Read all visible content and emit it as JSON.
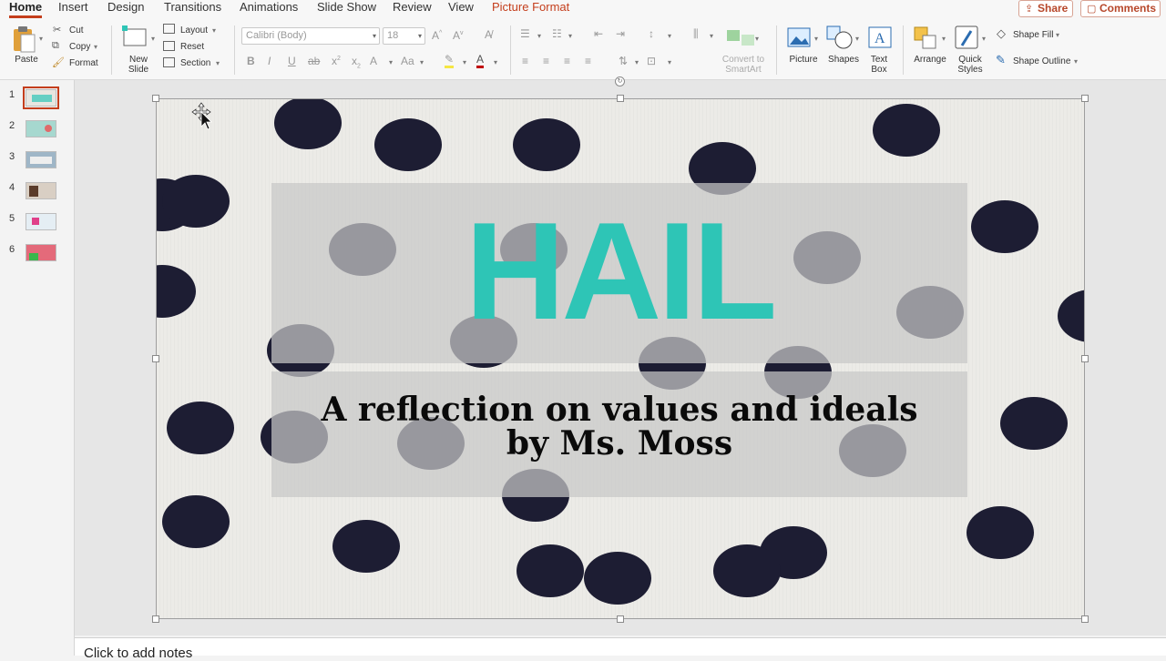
{
  "tabs": {
    "home": "Home",
    "insert": "Insert",
    "design": "Design",
    "transitions": "Transitions",
    "animations": "Animations",
    "slideshow": "Slide Show",
    "review": "Review",
    "view": "View",
    "picture_format": "Picture Format"
  },
  "header_buttons": {
    "share": "Share",
    "comments": "Comments"
  },
  "ribbon": {
    "paste": "Paste",
    "cut": "Cut",
    "copy": "Copy",
    "format": "Format",
    "new_slide_1": "New",
    "new_slide_2": "Slide",
    "layout": "Layout",
    "reset": "Reset",
    "section": "Section",
    "font_name": "Calibri (Body)",
    "font_size": "18",
    "convert_1": "Convert to",
    "convert_2": "SmartArt",
    "picture": "Picture",
    "shapes": "Shapes",
    "textbox_1": "Text",
    "textbox_2": "Box",
    "arrange": "Arrange",
    "quick_styles_1": "Quick",
    "quick_styles_2": "Styles",
    "shape_fill": "Shape Fill",
    "shape_outline": "Shape Outline"
  },
  "thumbnails": [
    "1",
    "2",
    "3",
    "4",
    "5",
    "6"
  ],
  "slide": {
    "title": "HAIL",
    "subtitle_line1": "A reflection on values and ideals",
    "subtitle_line2": "by Ms. Moss"
  },
  "notes_placeholder": "Click to add notes",
  "colors": {
    "accent": "#c43e1c",
    "title_teal": "#2ec5b6",
    "dot_navy": "#1d1d33"
  }
}
